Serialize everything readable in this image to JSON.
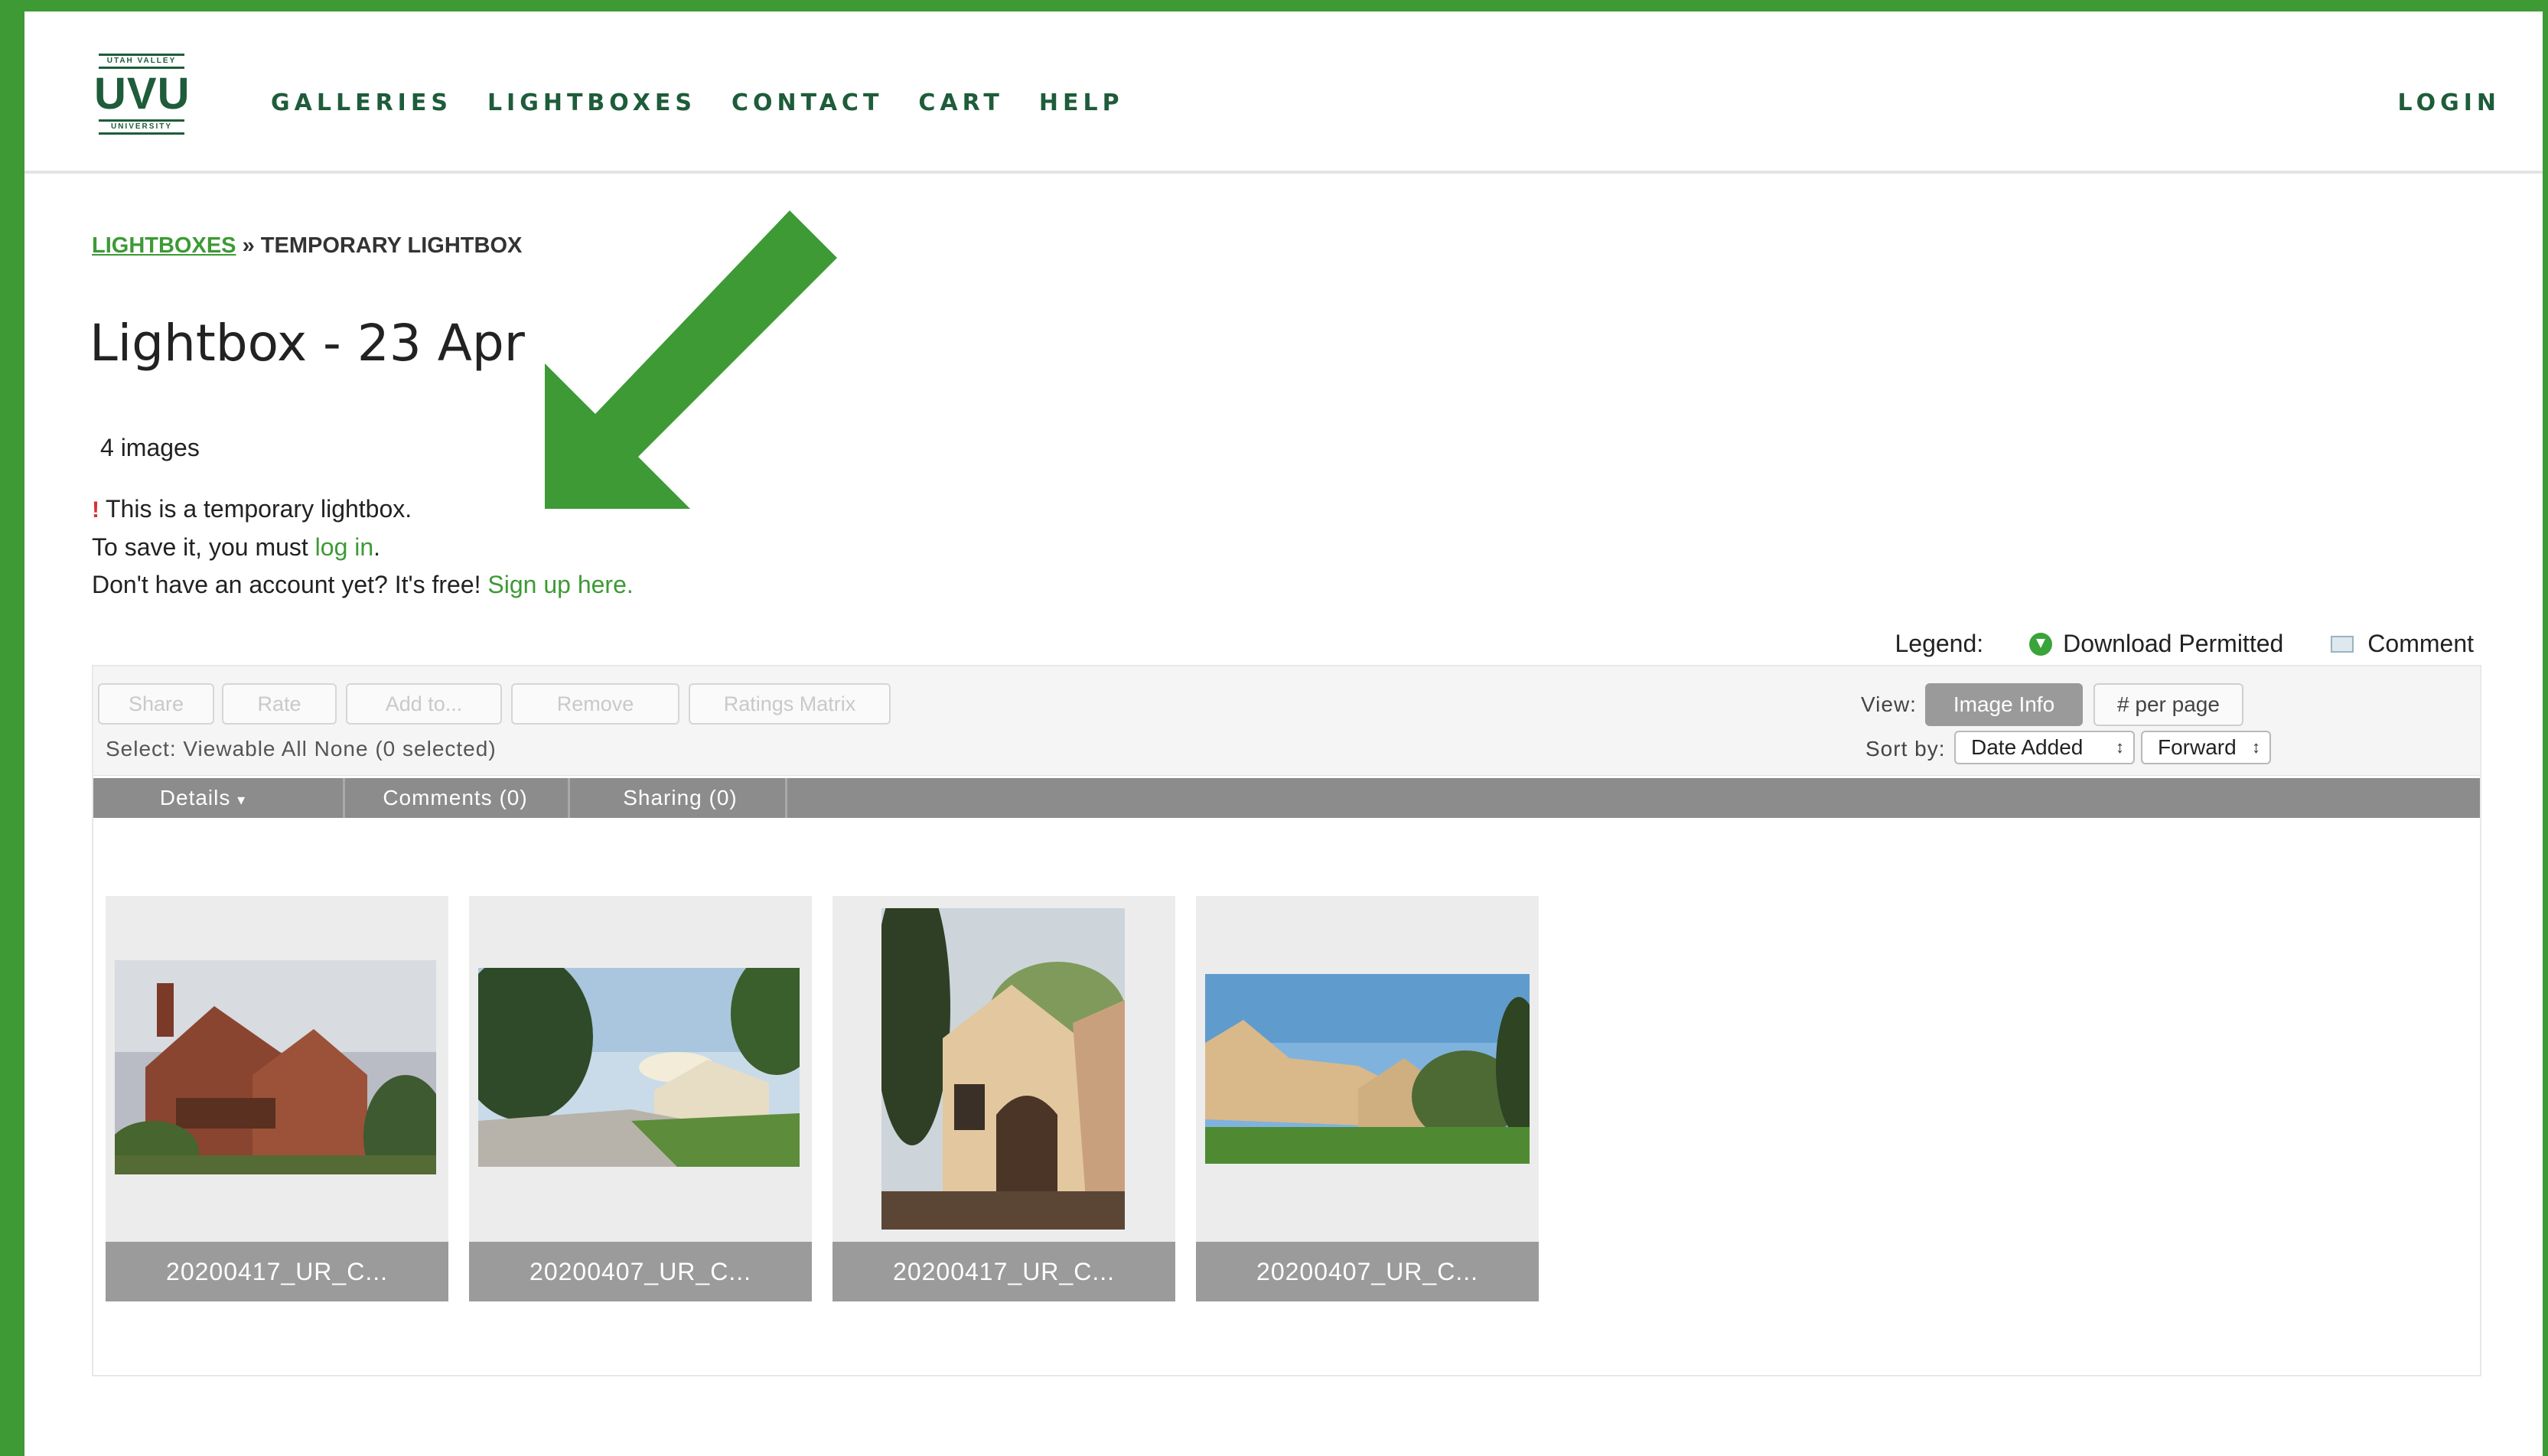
{
  "header": {
    "logo": {
      "top_text": "UTAH VALLEY",
      "main_text": "UVU",
      "bottom_text": "UNIVERSITY"
    },
    "nav": [
      "GALLERIES",
      "LIGHTBOXES",
      "CONTACT",
      "CART",
      "HELP"
    ],
    "login_label": "LOGIN"
  },
  "breadcrumb": {
    "link": "LIGHTBOXES",
    "separator": "»",
    "current": "TEMPORARY LIGHTBOX"
  },
  "page_title": "Lightbox - 23 Apr",
  "image_count": "4 images",
  "notice": {
    "warning_mark": "!",
    "line1": "This is a temporary lightbox.",
    "line2_prefix": "To save it, you must ",
    "line2_link": "log in",
    "line2_suffix": ".",
    "line3_prefix": "Don't have an account yet? It's free! ",
    "line3_link": "Sign up here."
  },
  "legend": {
    "label": "Legend:",
    "download": "Download Permitted",
    "comment": "Comment"
  },
  "toolbar": {
    "buttons": [
      "Share",
      "Rate",
      "Add to...",
      "Remove",
      "Ratings Matrix"
    ],
    "select_line": "Select:  Viewable  All  None  (0 selected)",
    "view_label": "View:",
    "image_info": "Image Info",
    "per_page": "# per page",
    "sort_label": "Sort by:",
    "sort_field": "Date Added",
    "sort_direction": "Forward"
  },
  "tabs": [
    "Details",
    "Comments (0)",
    "Sharing (0)"
  ],
  "thumbnails": [
    {
      "caption": "20200417_UR_C..."
    },
    {
      "caption": "20200407_UR_C..."
    },
    {
      "caption": "20200417_UR_C..."
    },
    {
      "caption": "20200407_UR_C..."
    }
  ],
  "colors": {
    "frame_green": "#3d9a35",
    "nav_green": "#1e5c3a",
    "link_green": "#3d9a35",
    "tab_bar": "#8c8c8c"
  }
}
